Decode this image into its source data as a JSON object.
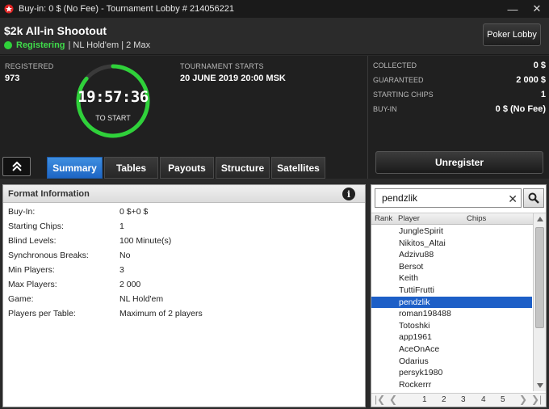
{
  "window": {
    "title": "Buy-in: 0 $ (No Fee) - Tournament Lobby # 214056221",
    "minimize": "—",
    "close": "✕"
  },
  "header": {
    "tournament_name": "$2k All-in Shootout",
    "status": "Registering",
    "details": "| NL Hold'em | 2 Max",
    "poker_lobby_button": "Poker Lobby"
  },
  "info": {
    "registered_label": "REGISTERED",
    "registered_value": "973",
    "starts_label": "TOURNAMENT STARTS",
    "starts_value": "20 JUNE 2019  20:00 MSK",
    "clock_time": "19:57:36",
    "clock_sub": "TO START",
    "collected_label": "COLLECTED",
    "collected_value": "0 $",
    "guaranteed_label": "GUARANTEED",
    "guaranteed_value": "2 000 $",
    "starting_chips_label": "STARTING CHIPS",
    "starting_chips_value": "1",
    "buyin_label": "BUY-IN",
    "buyin_value": "0 $ (No Fee)"
  },
  "tabs": [
    {
      "label": "Summary",
      "active": true
    },
    {
      "label": "Tables",
      "active": false
    },
    {
      "label": "Payouts",
      "active": false
    },
    {
      "label": "Structure",
      "active": false
    },
    {
      "label": "Satellites",
      "active": false
    }
  ],
  "unregister_button": "Unregister",
  "format": {
    "title": "Format Information",
    "info_icon": "i",
    "rows": [
      {
        "label": "Buy-In:",
        "value": "0 $+0 $"
      },
      {
        "label": "Starting Chips:",
        "value": "1"
      },
      {
        "label": "Blind Levels:",
        "value": "100 Minute(s)"
      },
      {
        "label": "Synchronous Breaks:",
        "value": "No"
      },
      {
        "label": "Min Players:",
        "value": "3"
      },
      {
        "label": "Max Players:",
        "value": "2 000"
      },
      {
        "label": "Game:",
        "value": "NL Hold'em"
      },
      {
        "label": "Players per Table:",
        "value": "Maximum of 2 players"
      }
    ]
  },
  "players": {
    "search_value": "pendzlik",
    "clear": "✕",
    "columns": {
      "rank": "Rank",
      "player": "Player",
      "chips": "Chips"
    },
    "list": [
      "JungleSpirit",
      "Nikitos_Altai",
      "Adzivu88",
      "Bersot",
      "Keith",
      "TuttiFrutti",
      "pendzlik",
      "roman198488",
      "Totoshki",
      "app1961",
      "AceOnAce",
      "Odarius",
      "persyk1980",
      "Rockerrr"
    ],
    "selected_index": 6,
    "pager": {
      "first": "|❮",
      "prev": "❮",
      "next": "❯",
      "last": "❯|",
      "pages": [
        "1",
        "2",
        "3",
        "4",
        "5"
      ]
    }
  },
  "colors": {
    "accent_blue": "#1d5fc7",
    "status_green": "#2fd13a",
    "clock_ring": "#2fd13a"
  },
  "clock_progress": 0.86
}
